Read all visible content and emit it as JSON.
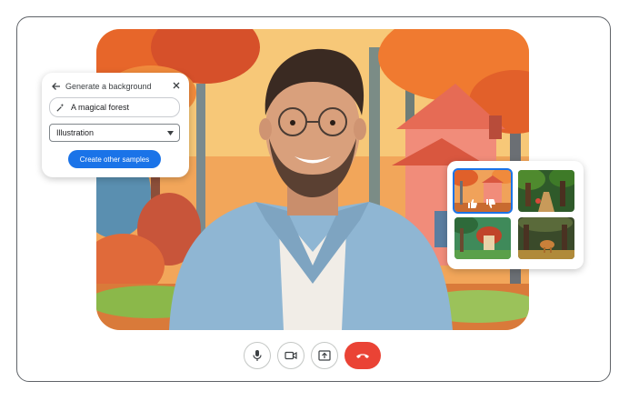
{
  "generate_panel": {
    "title": "Generate a background",
    "prompt": "A magical forest",
    "style": "Illustration",
    "button_label": "Create other samples"
  },
  "samples_panel": {
    "thumbnails": [
      "magical-forest-house",
      "forest-path",
      "mushroom-house",
      "forest-deer"
    ],
    "selected_index": 0
  },
  "controls": {
    "icons": [
      "mic-icon",
      "camera-icon",
      "present-icon",
      "hang-up-icon"
    ]
  },
  "colors": {
    "accent": "#1a73e8",
    "end_call": "#ea4335",
    "frame_border": "#5f6368"
  }
}
